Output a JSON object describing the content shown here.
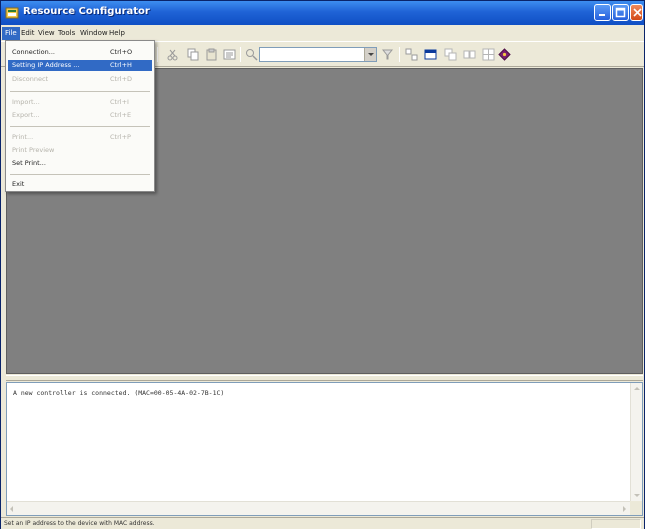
{
  "window": {
    "title": "Resource Configurator",
    "minimize_icon": "minimize-icon",
    "maximize_icon": "maximize-icon",
    "close_icon": "close-icon"
  },
  "menubar": {
    "items": [
      {
        "label": "File",
        "active": true
      },
      {
        "label": "Edit"
      },
      {
        "label": "View"
      },
      {
        "label": "Tools"
      },
      {
        "label": "Window"
      },
      {
        "label": "Help"
      }
    ]
  },
  "file_menu": {
    "items": [
      {
        "label": "Connection...",
        "shortcut": "Ctrl+O",
        "state": "enabled"
      },
      {
        "label": "Setting IP Address ...",
        "shortcut": "Ctrl+H",
        "state": "highlighted"
      },
      {
        "label": "Disconnect",
        "shortcut": "Ctrl+D",
        "state": "disabled"
      },
      {
        "label": "Import...",
        "shortcut": "Ctrl+I",
        "state": "disabled"
      },
      {
        "label": "Export...",
        "shortcut": "Ctrl+E",
        "state": "disabled"
      },
      {
        "label": "Print...",
        "shortcut": "Ctrl+P",
        "state": "disabled"
      },
      {
        "label": "Print Preview",
        "shortcut": "",
        "state": "disabled"
      },
      {
        "label": "Set Print...",
        "shortcut": "",
        "state": "enabled"
      },
      {
        "label": "Exit",
        "shortcut": "",
        "state": "enabled"
      }
    ]
  },
  "toolbar": {
    "combo_value": ""
  },
  "log": {
    "lines": [
      "A new controller is connected. (MAC=00-05-4A-02-7B-1C)"
    ]
  },
  "statusbar": {
    "text": "Set an IP address to the device with MAC address."
  },
  "colors": {
    "titlebar": "#1f63d6",
    "workspace": "#808080",
    "menu_highlight": "#316ac5"
  }
}
